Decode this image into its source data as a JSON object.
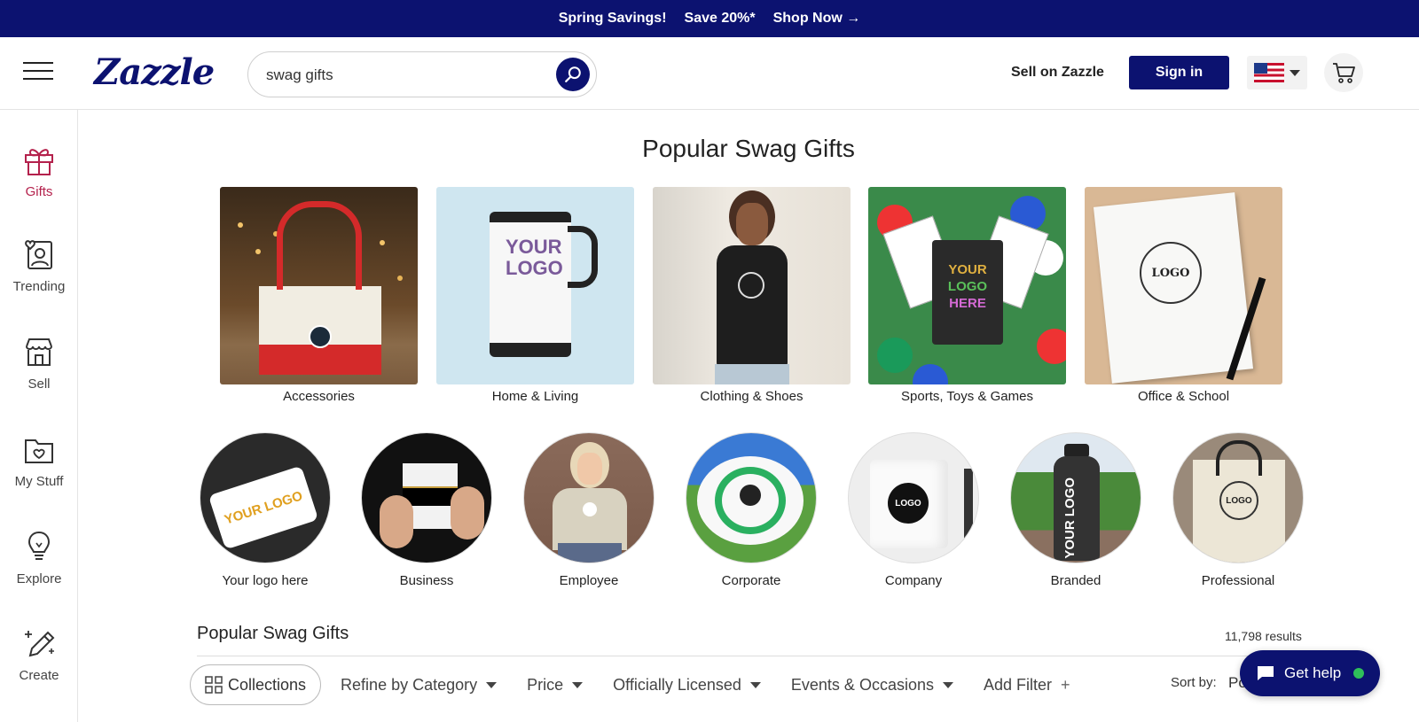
{
  "promo": {
    "item1": "Spring Savings!",
    "item2": "Save 20%*",
    "item3": "Shop Now →"
  },
  "header": {
    "logo": "Zazzle",
    "search_value": "swag gifts",
    "sell_link": "Sell on Zazzle",
    "signin": "Sign in"
  },
  "sidebar": {
    "items": [
      {
        "label": "Gifts",
        "icon": "gift-icon",
        "active": true
      },
      {
        "label": "Trending",
        "icon": "trending-icon"
      },
      {
        "label": "Sell",
        "icon": "storefront-icon"
      },
      {
        "label": "My Stuff",
        "icon": "folder-heart-icon"
      },
      {
        "label": "Explore",
        "icon": "lightbulb-icon"
      },
      {
        "label": "Create",
        "icon": "pencil-sparkle-icon"
      }
    ]
  },
  "main": {
    "title": "Popular Swag Gifts",
    "categories": [
      {
        "label": "Accessories"
      },
      {
        "label": "Home & Living"
      },
      {
        "label": "Clothing & Shoes"
      },
      {
        "label": "Sports, Toys & Games"
      },
      {
        "label": "Office & School"
      }
    ],
    "circles": [
      {
        "label": "Your logo here"
      },
      {
        "label": "Business"
      },
      {
        "label": "Employee"
      },
      {
        "label": "Corporate"
      },
      {
        "label": "Company"
      },
      {
        "label": "Branded"
      },
      {
        "label": "Professional"
      }
    ],
    "section_title": "Popular Swag Gifts",
    "results": "11,798 results"
  },
  "filters": {
    "collections": "Collections",
    "items": [
      "Refine by Category",
      "Price",
      "Officially Licensed",
      "Events & Occasions"
    ],
    "add_filter": "Add Filter",
    "add_symbol": "+",
    "sort_label": "Sort by:",
    "sort_value": "Po"
  },
  "help": {
    "label": "Get help"
  },
  "colors": {
    "brand": "#0c1270",
    "accent": "#b4214c",
    "online": "#2fbf5a"
  }
}
